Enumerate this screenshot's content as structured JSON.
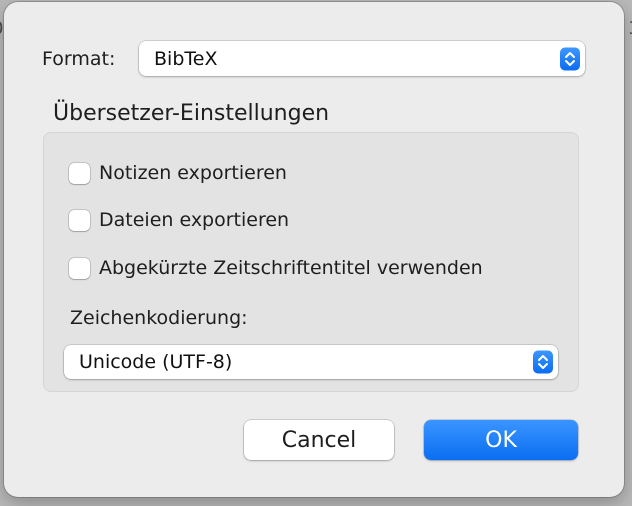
{
  "background_edges": {
    "left_glyph": "0",
    "right_glyph": "3"
  },
  "format": {
    "label": "Format:",
    "selected": "BibTeX",
    "control_icon": "up-down-chevron-icon"
  },
  "translator_settings": {
    "title": "Übersetzer-Einstellungen",
    "options": [
      {
        "label": "Notizen exportieren",
        "checked": false
      },
      {
        "label": "Dateien exportieren",
        "checked": false
      },
      {
        "label": "Abgekürzte Zeitschriftentitel verwenden",
        "checked": false
      }
    ],
    "encoding_label": "Zeichenkodierung:",
    "encoding_selected": "Unicode (UTF-8)"
  },
  "buttons": {
    "cancel": "Cancel",
    "ok": "OK"
  },
  "colors": {
    "accent": "#0a6cf0",
    "dialog_bg": "#ececec",
    "group_bg": "#e3e3e3"
  }
}
